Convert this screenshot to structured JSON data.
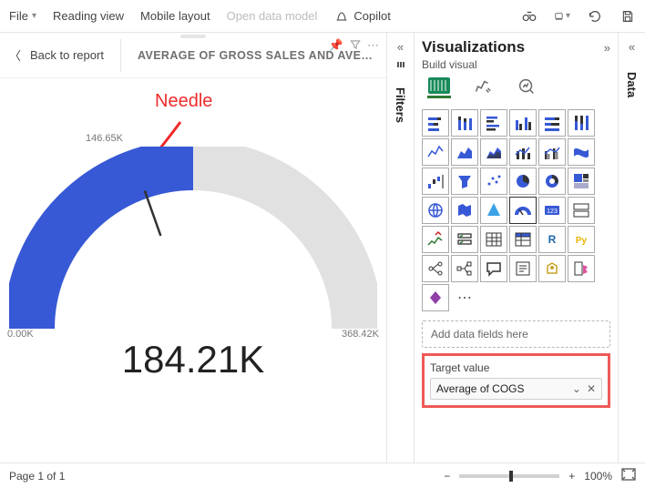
{
  "toolbar": {
    "file_label": "File",
    "reading_view_label": "Reading view",
    "mobile_layout_label": "Mobile layout",
    "open_data_model_label": "Open data model",
    "copilot_label": "Copilot"
  },
  "header": {
    "back_label": "Back to report",
    "chart_title": "AVERAGE OF GROSS SALES AND AVERAG..."
  },
  "annotations": {
    "needle_label": "Needle"
  },
  "panes": {
    "filters_label": "Filters",
    "data_label": "Data"
  },
  "viz": {
    "title": "Visualizations",
    "build_label": "Build visual",
    "values_well_placeholder": "Add data fields here",
    "target_label": "Target value",
    "target_pill": "Average of COGS",
    "more": "⋯"
  },
  "chart_data": {
    "type": "gauge",
    "value_label": "184.21K",
    "value": 184.21,
    "min_label": "0.00K",
    "min": 0,
    "max_label": "368.42K",
    "max": 368.42,
    "target_label": "146.65K",
    "target": 146.65,
    "title": "AVERAGE OF GROSS SALES AND AVERAGE OF COGS",
    "fill_color": "#3759d6",
    "track_color": "#e1e1e1",
    "needle_deg_from_left": 71.6
  },
  "status": {
    "page_label": "Page 1 of 1",
    "zoom_label": "100%"
  }
}
